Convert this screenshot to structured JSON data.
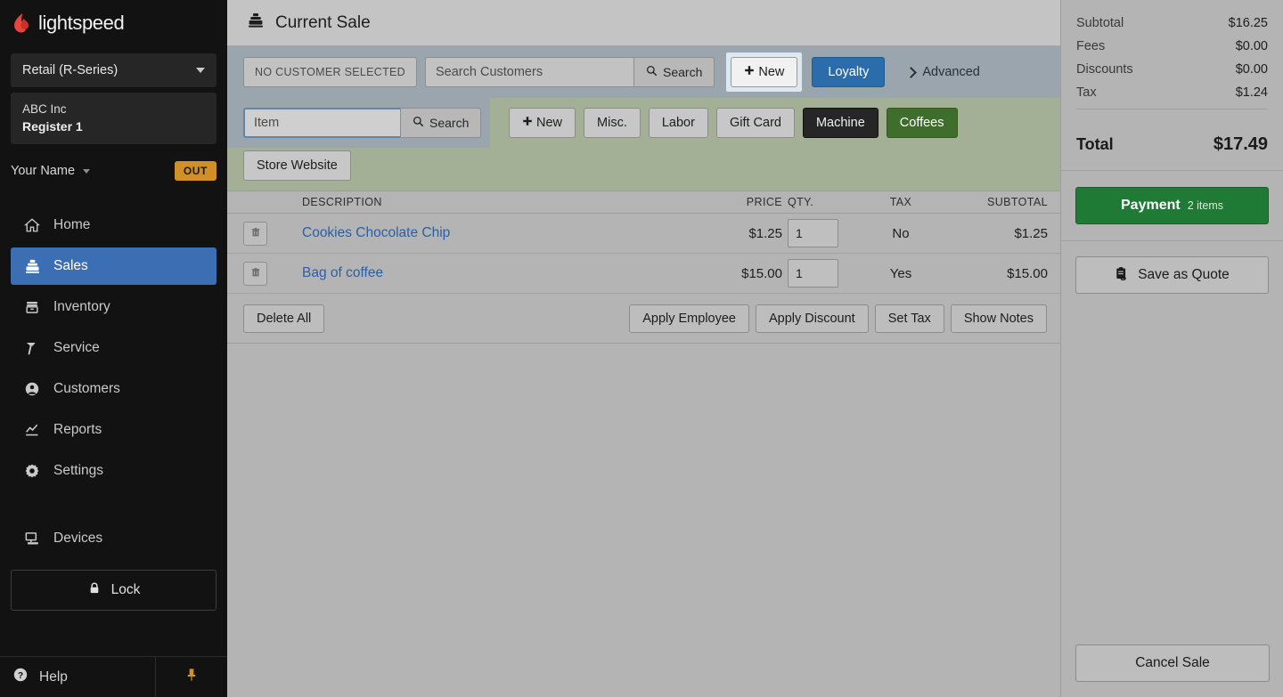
{
  "brand": {
    "name": "lightspeed",
    "accent": "#e8453c"
  },
  "sidebar": {
    "series_select": {
      "value": "Retail (R-Series)",
      "icon": "chevron-down-icon"
    },
    "store": {
      "company": "ABC Inc",
      "register": "Register 1"
    },
    "user": {
      "name": "Your Name",
      "status_badge": "OUT"
    },
    "items": [
      {
        "label": "Home",
        "icon": "home-icon",
        "active": false
      },
      {
        "label": "Sales",
        "icon": "cash-register-icon",
        "active": true
      },
      {
        "label": "Inventory",
        "icon": "box-icon",
        "active": false
      },
      {
        "label": "Service",
        "icon": "hammer-icon",
        "active": false
      },
      {
        "label": "Customers",
        "icon": "user-circle-icon",
        "active": false
      },
      {
        "label": "Reports",
        "icon": "chart-line-icon",
        "active": false
      },
      {
        "label": "Settings",
        "icon": "gear-icon",
        "active": false
      }
    ],
    "devices": {
      "label": "Devices",
      "icon": "monitor-icon"
    },
    "lock": {
      "label": "Lock",
      "icon": "lock-icon"
    },
    "help": {
      "label": "Help",
      "icon": "question-circle-icon"
    },
    "pin": {
      "icon": "pin-icon",
      "color": "#d18f27"
    }
  },
  "header": {
    "title": "Current Sale",
    "icon": "cash-register-icon"
  },
  "customer_bar": {
    "no_customer_label": "NO CUSTOMER SELECTED",
    "search_placeholder": "Search Customers",
    "search_value": "",
    "search_button": "Search",
    "new_button": "New",
    "loyalty_button": "Loyalty",
    "advanced_link": "Advanced"
  },
  "item_bar": {
    "item_placeholder": "Item",
    "item_value": "",
    "search_button": "Search",
    "tabs": [
      {
        "label": "New",
        "style": "plus"
      },
      {
        "label": "Misc.",
        "style": "default"
      },
      {
        "label": "Labor",
        "style": "default"
      },
      {
        "label": "Gift Card",
        "style": "default"
      },
      {
        "label": "Machine",
        "style": "dark"
      },
      {
        "label": "Coffees",
        "style": "green"
      }
    ],
    "tabs_row2": [
      {
        "label": "Store Website",
        "style": "default"
      }
    ]
  },
  "table": {
    "columns": [
      "DESCRIPTION",
      "PRICE",
      "QTY.",
      "TAX",
      "SUBTOTAL"
    ],
    "rows": [
      {
        "description": "Cookies Chocolate Chip",
        "price": "$1.25",
        "qty": "1",
        "tax": "No",
        "subtotal": "$1.25"
      },
      {
        "description": "Bag of coffee",
        "price": "$15.00",
        "qty": "1",
        "tax": "Yes",
        "subtotal": "$15.00"
      }
    ]
  },
  "actions": {
    "delete_all": "Delete All",
    "right": [
      "Apply Employee",
      "Apply Discount",
      "Set Tax",
      "Show Notes"
    ]
  },
  "totals": {
    "lines": [
      {
        "label": "Subtotal",
        "value": "$16.25"
      },
      {
        "label": "Fees",
        "value": "$0.00"
      },
      {
        "label": "Discounts",
        "value": "$0.00"
      },
      {
        "label": "Tax",
        "value": "$1.24"
      }
    ],
    "total_label": "Total",
    "total_value": "$17.49"
  },
  "right_panel": {
    "payment_label": "Payment",
    "payment_count": "2 items",
    "payment_color": "#1f7a36",
    "save_quote_label": "Save as Quote",
    "save_quote_icon": "clipboard-icon",
    "cancel_label": "Cancel Sale"
  }
}
